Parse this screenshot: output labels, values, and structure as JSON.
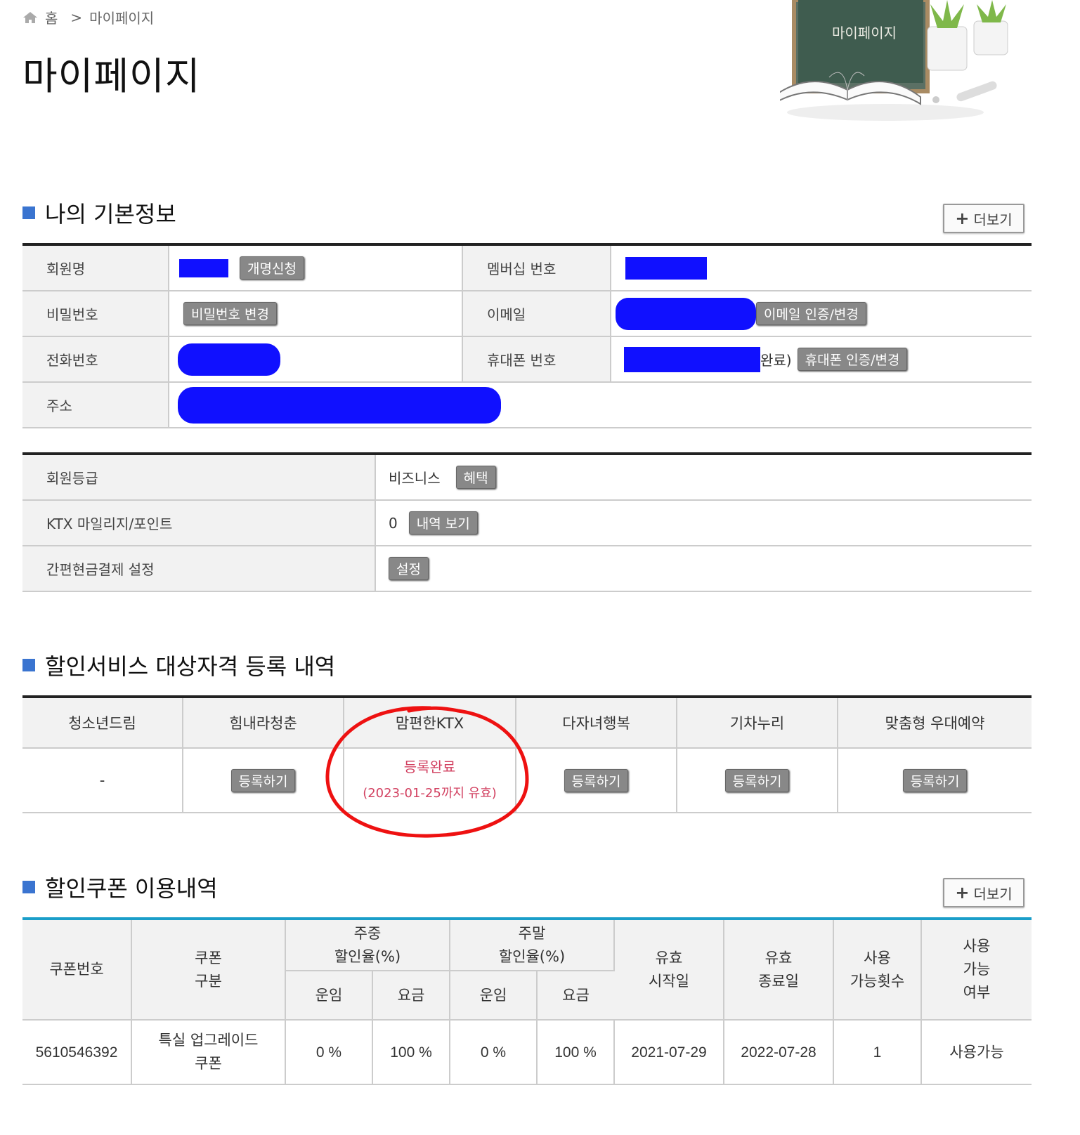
{
  "breadcrumb": {
    "home": "홈",
    "separator": ">",
    "current": "마이페이지"
  },
  "page_title": "마이페이지",
  "hero": {
    "board_text": "마이페이지"
  },
  "basic_info": {
    "title": "나의 기본정보",
    "more_label": "더보기",
    "name_label": "회원명",
    "rename_button": "개명신청",
    "membership_label": "멤버십 번호",
    "password_label": "비밀번호",
    "password_button": "비밀번호 변경",
    "email_label": "이메일",
    "email_button": "이메일 인증/변경",
    "phone_label": "전화번호",
    "mobile_label": "휴대폰 번호",
    "mobile_suffix": "완료)",
    "mobile_button": "휴대폰 인증/변경",
    "address_label": "주소"
  },
  "grade_info": {
    "grade_label": "회원등급",
    "grade_value": "비즈니스",
    "grade_button": "혜택",
    "mileage_label": "KTX 마일리지/포인트",
    "mileage_value": "0",
    "mileage_button": "내역 보기",
    "cash_label": "간편현금결제 설정",
    "cash_button": "설정"
  },
  "discount": {
    "title": "할인서비스 대상자격 등록 내역",
    "headers": [
      "청소년드림",
      "힘내라청춘",
      "맘편한KTX",
      "다자녀행복",
      "기차누리",
      "맞춤형 우대예약"
    ],
    "youth_value": "-",
    "register_button": "등록하기",
    "done_label": "등록완료",
    "done_note": "(2023-01-25까지 유효)"
  },
  "coupon": {
    "title": "할인쿠폰 이용내역",
    "more_label": "더보기",
    "headers": {
      "number": "쿠폰번호",
      "type": [
        "쿠폰",
        "구분"
      ],
      "weekday": [
        "주중",
        "할인율(%)"
      ],
      "weekend": [
        "주말",
        "할인율(%)"
      ],
      "fare": "운임",
      "charge": "요금",
      "start": [
        "유효",
        "시작일"
      ],
      "end": [
        "유효",
        "종료일"
      ],
      "count": [
        "사용",
        "가능횟수"
      ],
      "usable": [
        "사용",
        "가능",
        "여부"
      ]
    },
    "rows": [
      {
        "number": "5610546392",
        "type": [
          "특실 업그레이드",
          "쿠폰"
        ],
        "weekday_fare": "0 %",
        "weekday_charge": "100 %",
        "weekend_fare": "0 %",
        "weekend_charge": "100 %",
        "start": "2021-07-29",
        "end": "2022-07-28",
        "count": "1",
        "usable": "사용가능"
      }
    ]
  },
  "colors": {
    "accent_blue": "#3a74d0",
    "coupon_line": "#1a9ec9",
    "done_red": "#d24060",
    "redaction": "#1010ff",
    "annotation": "#ee1111"
  },
  "icons": [
    "home-icon",
    "plus-icon"
  ]
}
